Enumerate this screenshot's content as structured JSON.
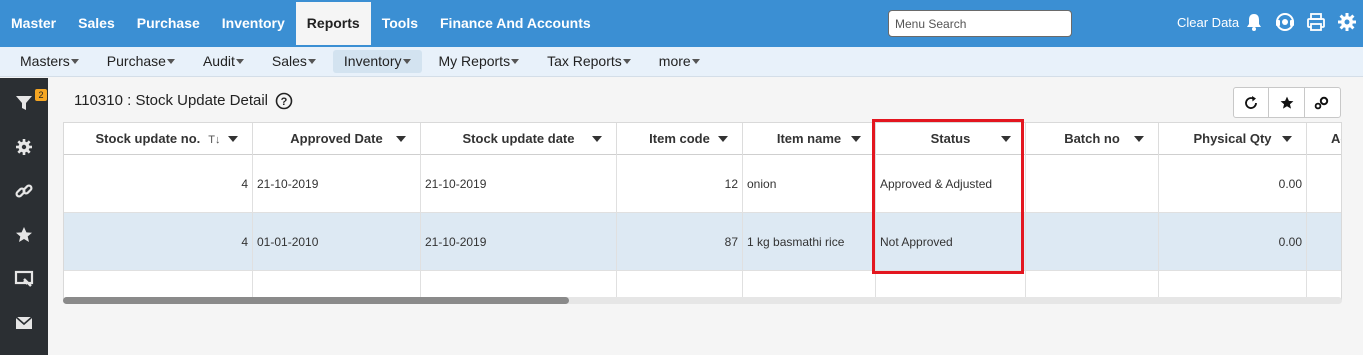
{
  "topnav": {
    "items": [
      "Master",
      "Sales",
      "Purchase",
      "Inventory",
      "Reports",
      "Tools",
      "Finance And Accounts"
    ],
    "active": "Reports",
    "search_placeholder": "Menu Search",
    "clear_data": "Clear Data",
    "icons": [
      "bell-icon",
      "support-icon",
      "print-icon",
      "gear-icon"
    ]
  },
  "subnav": {
    "items": [
      "Masters",
      "Purchase",
      "Audit",
      "Sales",
      "Inventory",
      "My Reports",
      "Tax Reports",
      "more"
    ],
    "active": "Inventory"
  },
  "rail": {
    "icons": [
      "filter-icon",
      "settings-icon",
      "link-icon",
      "star-icon",
      "screen-icon",
      "mail-icon"
    ],
    "filter_badge": "2"
  },
  "page": {
    "title": "110310 : Stock Update Detail"
  },
  "grid": {
    "columns": [
      "Stock update no.",
      "Approved Date",
      "Stock update date",
      "Item code",
      "Item name",
      "Status",
      "Batch no",
      "Physical Qty",
      "Act"
    ],
    "rows": [
      [
        "4",
        "21-10-2019",
        "21-10-2019",
        "12",
        "onion",
        "Approved & Adjusted",
        "",
        "0.00"
      ],
      [
        "4",
        "01-01-2010",
        "21-10-2019",
        "87",
        "1 kg basmathi rice",
        "Not Approved",
        "",
        "0.00"
      ]
    ],
    "sort_glyph": "T↓"
  },
  "colors": {
    "topbar": "#3b8fd3",
    "subbar": "#e8f1fa",
    "rail": "#2b2f33",
    "selected_row": "#dde9f3",
    "highlight_box": "#e3161f"
  }
}
